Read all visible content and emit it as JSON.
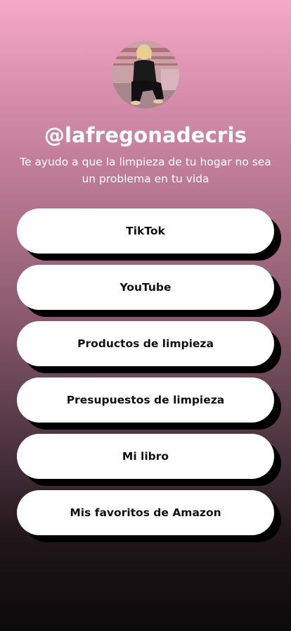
{
  "profile": {
    "handle": "@lafregonadecris",
    "bio": "Te ayudo a que la limpieza de tu hogar no sea un problema en tu vida",
    "avatar_icon": "profile-photo"
  },
  "links": [
    {
      "label": "TikTok"
    },
    {
      "label": "YouTube"
    },
    {
      "label": "Productos de limpieza"
    },
    {
      "label": "Presupuestos de limpieza"
    },
    {
      "label": "Mi libro"
    },
    {
      "label": "Mis favoritos de Amazon"
    }
  ],
  "colors": {
    "gradient_top": "#f5a9c6",
    "gradient_bottom": "#0b0a0b",
    "button_bg": "#ffffff",
    "button_shadow": "#000000",
    "text_light": "#ffffff",
    "text_dark": "#111111"
  }
}
